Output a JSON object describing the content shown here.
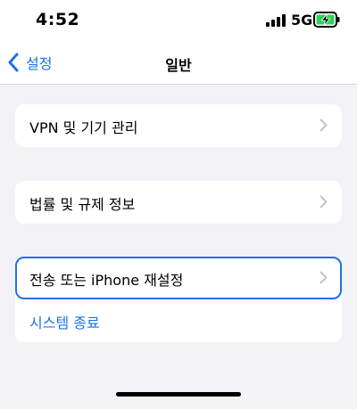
{
  "status_bar": {
    "time": "4:52",
    "network": "5G",
    "icons": [
      "signal-icon",
      "battery-charging-icon"
    ]
  },
  "nav": {
    "back_label": "설정",
    "title": "일반"
  },
  "groups": [
    {
      "rows": [
        {
          "label": "VPN 및 기기 관리",
          "icon": "chevron-right-icon"
        }
      ]
    },
    {
      "rows": [
        {
          "label": "법률 및 규제 정보",
          "icon": "chevron-right-icon"
        }
      ]
    },
    {
      "rows": [
        {
          "label": "전송 또는 iPhone 재설정",
          "icon": "chevron-right-icon",
          "selected": true
        },
        {
          "label": "시스템 종료",
          "style": "link"
        }
      ]
    }
  ],
  "colors": {
    "accent": "#1a73e8",
    "background": "#f2f2f7",
    "battery_charge": "#30d158"
  }
}
